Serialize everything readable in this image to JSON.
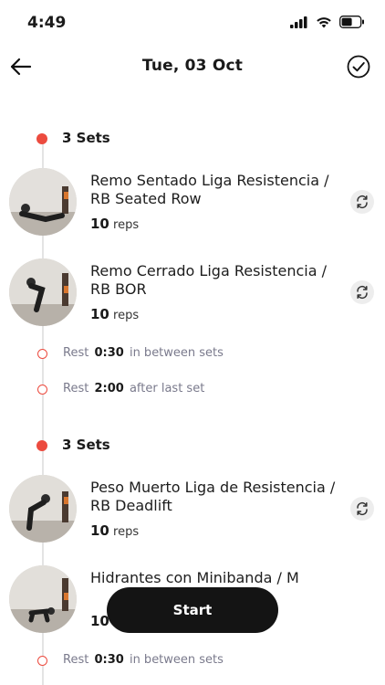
{
  "status_bar": {
    "time": "4:49"
  },
  "header": {
    "title": "Tue, 03 Oct",
    "back_icon": "arrow-left-icon",
    "done_icon": "check-circle-icon"
  },
  "blocks": [
    {
      "sets_label": "3 Sets",
      "exercises": [
        {
          "name": "Remo Sentado Liga Resistencia / RB Seated Row",
          "reps": "10",
          "reps_unit": "reps"
        },
        {
          "name": "Remo Cerrado Liga Resistencia / RB BOR",
          "reps": "10",
          "reps_unit": "reps"
        }
      ],
      "rests": [
        {
          "label": "Rest",
          "value": "0:30",
          "suffix": "in between sets"
        },
        {
          "label": "Rest",
          "value": "2:00",
          "suffix": "after last set"
        }
      ]
    },
    {
      "sets_label": "3 Sets",
      "exercises": [
        {
          "name": "Peso Muerto Liga de Resistencia / RB Deadlift",
          "reps": "10",
          "reps_unit": "reps"
        },
        {
          "name": "Hidrantes con Minibanda / M",
          "reps": "10",
          "reps_unit": ""
        }
      ],
      "rests": [
        {
          "label": "Rest",
          "value": "0:30",
          "suffix": "in between sets"
        }
      ]
    }
  ],
  "start_button": {
    "label": "Start"
  },
  "colors": {
    "accent": "#ec4b3f",
    "button": "#141414"
  }
}
